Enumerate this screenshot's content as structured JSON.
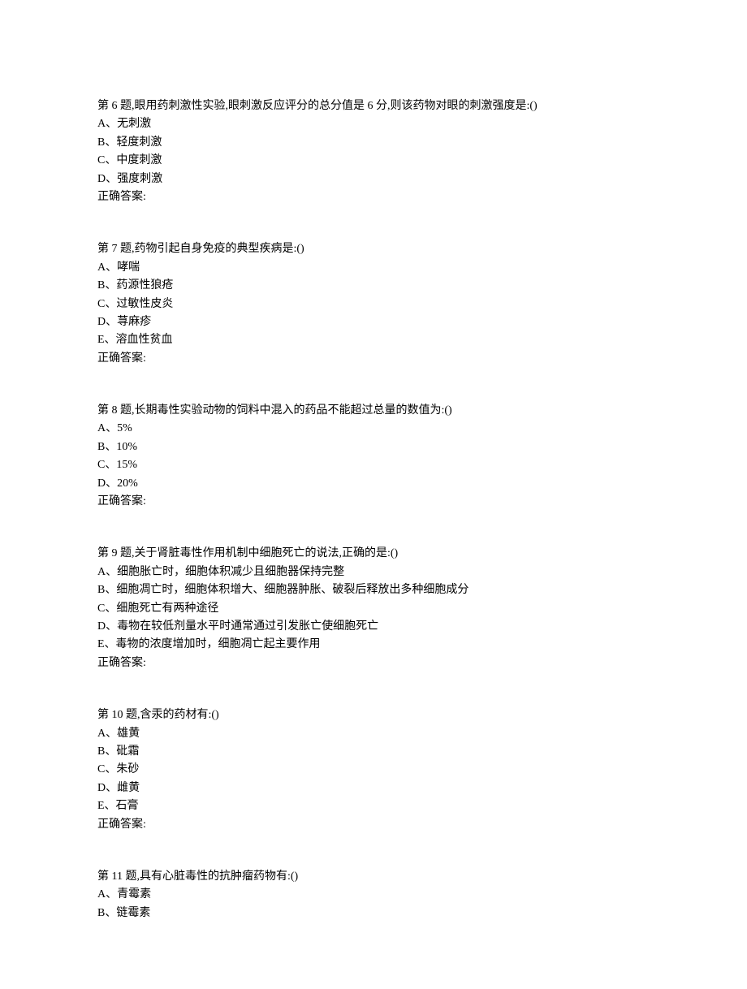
{
  "questions": [
    {
      "title": "第 6 题,眼用药刺激性实验,眼刺激反应评分的总分值是 6 分,则该药物对眼的刺激强度是:()",
      "options": [
        "A、无刺激",
        "B、轻度刺激",
        "C、中度刺激",
        "D、强度刺激"
      ],
      "answer_label": "正确答案:"
    },
    {
      "title": "第 7 题,药物引起自身免疫的典型疾病是:()",
      "options": [
        "A、哮喘",
        "B、药源性狼疮",
        "C、过敏性皮炎",
        "D、荨麻疹",
        "E、溶血性贫血"
      ],
      "answer_label": "正确答案:"
    },
    {
      "title": "第 8 题,长期毒性实验动物的饲料中混入的药品不能超过总量的数值为:()",
      "options": [
        "A、5%",
        "B、10%",
        "C、15%",
        "D、20%"
      ],
      "answer_label": "正确答案:"
    },
    {
      "title": "第 9 题,关于肾脏毒性作用机制中细胞死亡的说法,正确的是:()",
      "options": [
        "A、细胞胀亡时，细胞体积减少且细胞器保持完整",
        "B、细胞凋亡时，细胞体积增大、细胞器肿胀、破裂后释放出多种细胞成分",
        "C、细胞死亡有两种途径",
        "D、毒物在较低剂量水平时通常通过引发胀亡使细胞死亡",
        "E、毒物的浓度增加时，细胞凋亡起主要作用"
      ],
      "answer_label": "正确答案:"
    },
    {
      "title": "第 10 题,含汞的药材有:()",
      "options": [
        "A、雄黄",
        "B、砒霜",
        "C、朱砂",
        "D、雌黄",
        "E、石膏"
      ],
      "answer_label": "正确答案:"
    },
    {
      "title": "第 11 题,具有心脏毒性的抗肿瘤药物有:()",
      "options": [
        "A、青霉素",
        "B、链霉素"
      ],
      "answer_label": ""
    }
  ]
}
